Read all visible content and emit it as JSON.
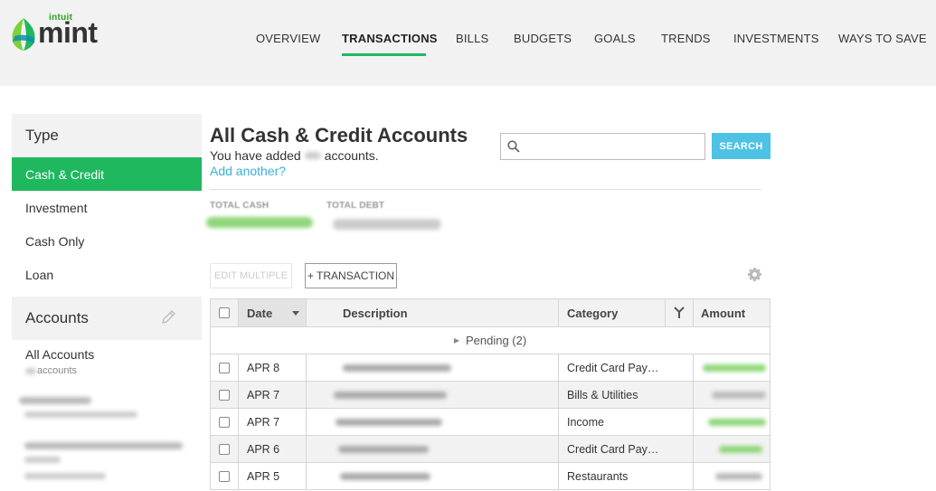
{
  "brand": {
    "company": "intuit",
    "product": "mint",
    "accent": "#1fb85f",
    "link_color": "#3ab0d8",
    "button_color": "#4ec2e5"
  },
  "nav": {
    "items": [
      "OVERVIEW",
      "TRANSACTIONS",
      "BILLS",
      "BUDGETS",
      "GOALS",
      "TRENDS",
      "INVESTMENTS",
      "WAYS TO SAVE"
    ],
    "active": "TRANSACTIONS"
  },
  "sidebar": {
    "type_heading": "Type",
    "types": [
      "Cash & Credit",
      "Investment",
      "Cash Only",
      "Loan"
    ],
    "active_type": "Cash & Credit",
    "accounts_heading": "Accounts",
    "all_accounts_label": "All Accounts",
    "all_accounts_sub": "accounts"
  },
  "main": {
    "title": "All Cash & Credit Accounts",
    "added_prefix": "You have added",
    "added_suffix": "accounts.",
    "add_another": "Add another?",
    "search_placeholder": "",
    "search_button": "SEARCH",
    "total_cash_label": "TOTAL CASH",
    "total_debt_label": "TOTAL DEBT",
    "edit_multiple": "EDIT MULTIPLE",
    "add_transaction": "+ TRANSACTION"
  },
  "table": {
    "columns": {
      "date": "Date",
      "description": "Description",
      "category": "Category",
      "amount": "Amount"
    },
    "pending_label": "Pending (2)",
    "rows": [
      {
        "date": "APR 8",
        "category": "Credit Card Pay…",
        "amount_type": "income"
      },
      {
        "date": "APR 7",
        "category": "Bills & Utilities",
        "amount_type": "expense"
      },
      {
        "date": "APR 7",
        "category": "Income",
        "amount_type": "income"
      },
      {
        "date": "APR 6",
        "category": "Credit Card Pay…",
        "amount_type": "income"
      },
      {
        "date": "APR 5",
        "category": "Restaurants",
        "amount_type": "expense"
      }
    ]
  },
  "icons": [
    "leaf-logo-icon",
    "search-icon",
    "pencil-icon",
    "gear-icon",
    "sort-down-icon",
    "split-icon",
    "expand-triangle-icon"
  ]
}
